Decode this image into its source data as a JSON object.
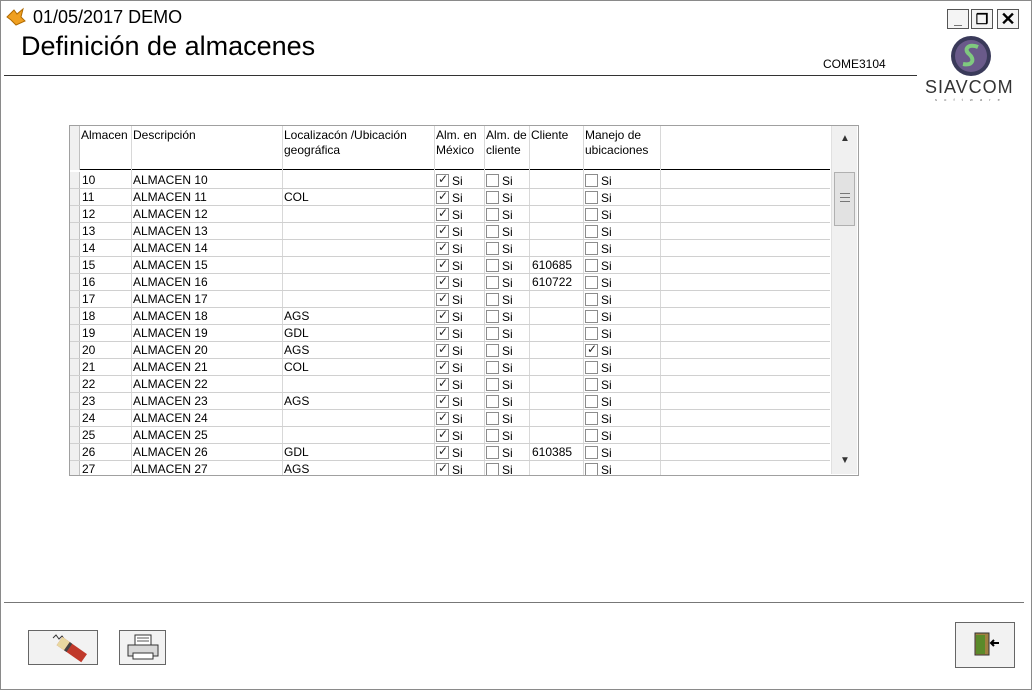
{
  "titlebar": {
    "title": "01/05/2017  DEMO",
    "minimize_label": "_",
    "maximize_label": "❐",
    "close_label": "✕"
  },
  "page": {
    "title": "Definición de almacenes",
    "form_code": "COME3104"
  },
  "logo": {
    "name": "SIAVCOM",
    "tagline": "s o f t w a r e"
  },
  "table": {
    "columns": [
      "Almacen",
      "Descripción",
      "Localizacón /Ubicación geográfica",
      "Alm. en México",
      "Alm. de cliente",
      "Cliente",
      "Manejo de ubicaciones"
    ],
    "checkbox_label": "Si",
    "rows": [
      {
        "almacen": "10",
        "descripcion": "ALMACEN 10",
        "localizacion": "",
        "mexico": true,
        "alm_cliente": false,
        "cliente": "",
        "ubicaciones": false
      },
      {
        "almacen": "11",
        "descripcion": "ALMACEN 11",
        "localizacion": "COL",
        "mexico": true,
        "alm_cliente": false,
        "cliente": "",
        "ubicaciones": false
      },
      {
        "almacen": "12",
        "descripcion": "ALMACEN 12",
        "localizacion": "",
        "mexico": true,
        "alm_cliente": false,
        "cliente": "",
        "ubicaciones": false
      },
      {
        "almacen": "13",
        "descripcion": "ALMACEN 13",
        "localizacion": "",
        "mexico": true,
        "alm_cliente": false,
        "cliente": "",
        "ubicaciones": false
      },
      {
        "almacen": "14",
        "descripcion": "ALMACEN 14",
        "localizacion": "",
        "mexico": true,
        "alm_cliente": false,
        "cliente": "",
        "ubicaciones": false
      },
      {
        "almacen": "15",
        "descripcion": "ALMACEN 15",
        "localizacion": "",
        "mexico": true,
        "alm_cliente": false,
        "cliente": "610685",
        "ubicaciones": false
      },
      {
        "almacen": "16",
        "descripcion": "ALMACEN 16",
        "localizacion": "",
        "mexico": true,
        "alm_cliente": false,
        "cliente": "610722",
        "ubicaciones": false
      },
      {
        "almacen": "17",
        "descripcion": "ALMACEN 17",
        "localizacion": "",
        "mexico": true,
        "alm_cliente": false,
        "cliente": "",
        "ubicaciones": false
      },
      {
        "almacen": "18",
        "descripcion": "ALMACEN 18",
        "localizacion": "AGS",
        "mexico": true,
        "alm_cliente": false,
        "cliente": "",
        "ubicaciones": false
      },
      {
        "almacen": "19",
        "descripcion": "ALMACEN 19",
        "localizacion": "GDL",
        "mexico": true,
        "alm_cliente": false,
        "cliente": "",
        "ubicaciones": false
      },
      {
        "almacen": "20",
        "descripcion": "ALMACEN 20",
        "localizacion": "AGS",
        "mexico": true,
        "alm_cliente": false,
        "cliente": "",
        "ubicaciones": true
      },
      {
        "almacen": "21",
        "descripcion": "ALMACEN 21",
        "localizacion": "COL",
        "mexico": true,
        "alm_cliente": false,
        "cliente": "",
        "ubicaciones": false
      },
      {
        "almacen": "22",
        "descripcion": "ALMACEN 22",
        "localizacion": "",
        "mexico": true,
        "alm_cliente": false,
        "cliente": "",
        "ubicaciones": false
      },
      {
        "almacen": "23",
        "descripcion": "ALMACEN 23",
        "localizacion": "AGS",
        "mexico": true,
        "alm_cliente": false,
        "cliente": "",
        "ubicaciones": false
      },
      {
        "almacen": "24",
        "descripcion": "ALMACEN 24",
        "localizacion": "",
        "mexico": true,
        "alm_cliente": false,
        "cliente": "",
        "ubicaciones": false
      },
      {
        "almacen": "25",
        "descripcion": "ALMACEN 25",
        "localizacion": "",
        "mexico": true,
        "alm_cliente": false,
        "cliente": "",
        "ubicaciones": false
      },
      {
        "almacen": "26",
        "descripcion": "ALMACEN 26",
        "localizacion": "GDL",
        "mexico": true,
        "alm_cliente": false,
        "cliente": "610385",
        "ubicaciones": false
      },
      {
        "almacen": "27",
        "descripcion": "ALMACEN 27",
        "localizacion": "AGS",
        "mexico": true,
        "alm_cliente": false,
        "cliente": "",
        "ubicaciones": false
      }
    ]
  },
  "buttons": {
    "eraser_icon": "eraser-icon",
    "print_icon": "printer-icon",
    "exit_icon": "exit-door-icon"
  }
}
